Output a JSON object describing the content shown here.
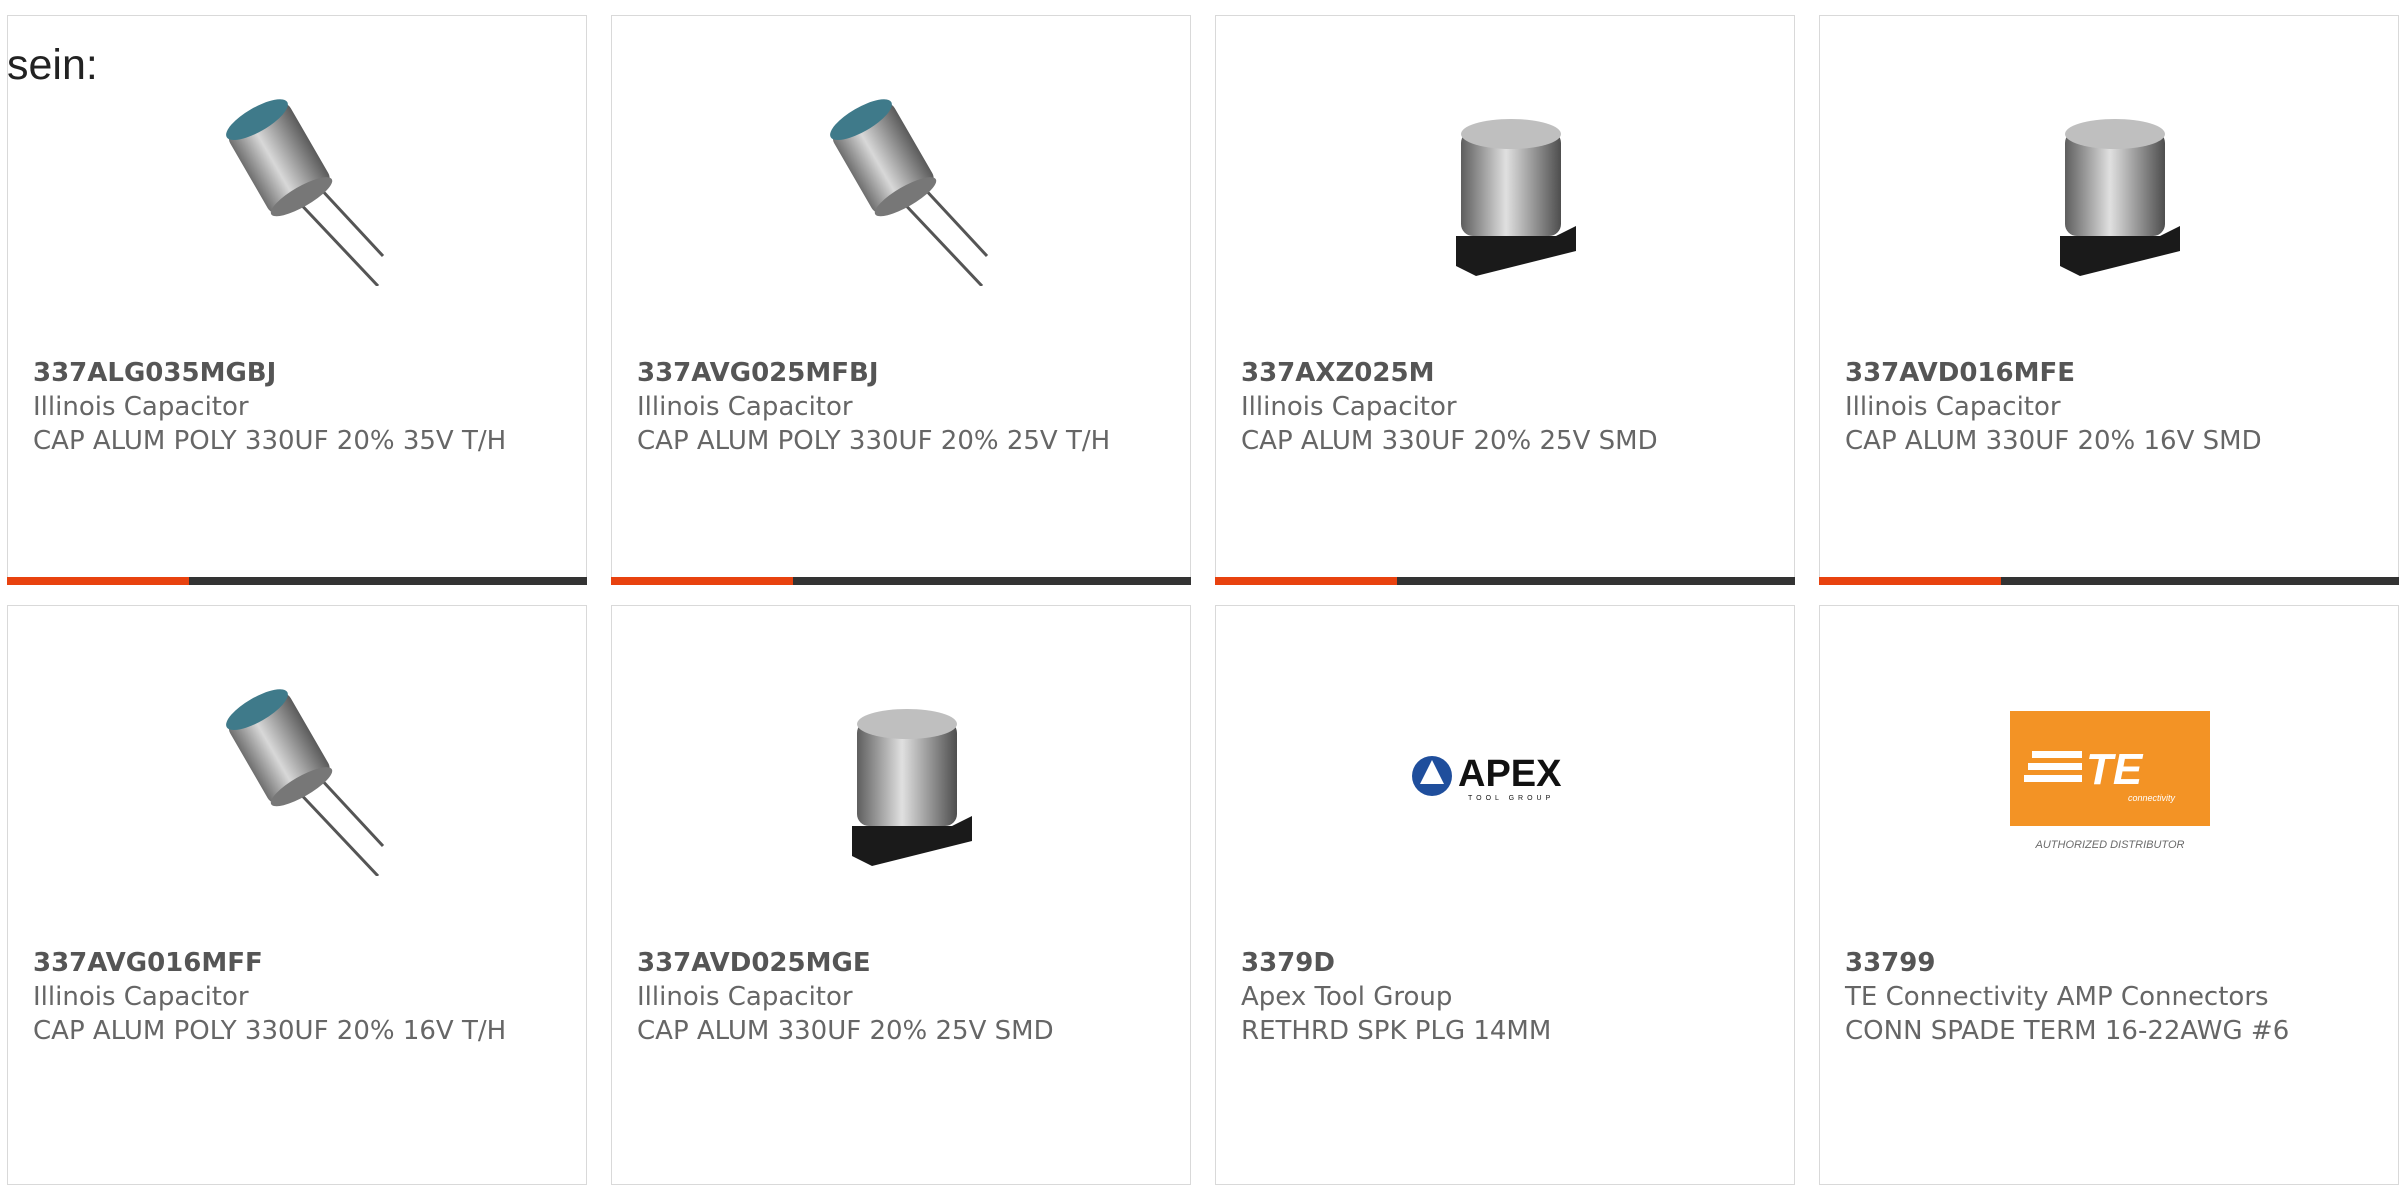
{
  "lead_text": "sein:",
  "colors": {
    "accent": "#e8420f",
    "bar_dark": "#333333",
    "te_orange": "#f39325"
  },
  "cards": [
    {
      "part_number": "337ALG035MGBJ",
      "manufacturer": "Illinois Capacitor",
      "description": "CAP ALUM POLY 330UF 20% 35V T/H",
      "image": "radial-capacitor",
      "has_bar": true
    },
    {
      "part_number": "337AVG025MFBJ",
      "manufacturer": "Illinois Capacitor",
      "description": "CAP ALUM POLY 330UF 20% 25V T/H",
      "image": "radial-capacitor",
      "has_bar": true
    },
    {
      "part_number": "337AXZ025M",
      "manufacturer": "Illinois Capacitor",
      "description": "CAP ALUM 330UF 20% 25V SMD",
      "image": "smd-capacitor",
      "has_bar": true
    },
    {
      "part_number": "337AVD016MFE",
      "manufacturer": "Illinois Capacitor",
      "description": "CAP ALUM 330UF 20% 16V SMD",
      "image": "smd-capacitor",
      "has_bar": true
    },
    {
      "part_number": "337AVG016MFF",
      "manufacturer": "Illinois Capacitor",
      "description": "CAP ALUM POLY 330UF 20% 16V T/H",
      "image": "radial-capacitor",
      "has_bar": false
    },
    {
      "part_number": "337AVD025MGE",
      "manufacturer": "Illinois Capacitor",
      "description": "CAP ALUM 330UF 20% 25V SMD",
      "image": "smd-capacitor",
      "has_bar": false
    },
    {
      "part_number": "3379D",
      "manufacturer": "Apex Tool Group",
      "description": "RETHRD SPK PLG 14MM",
      "image": "apex-logo",
      "has_bar": false
    },
    {
      "part_number": "33799",
      "manufacturer": "TE Connectivity AMP Connectors",
      "description": "CONN SPADE TERM 16-22AWG #6",
      "image": "te-logo",
      "has_bar": false
    }
  ],
  "apex_logo": {
    "word": "APEX",
    "sub": "TOOL GROUP"
  },
  "te_logo": {
    "word": "TE",
    "sub": "connectivity",
    "tagline": "AUTHORIZED DISTRIBUTOR"
  }
}
